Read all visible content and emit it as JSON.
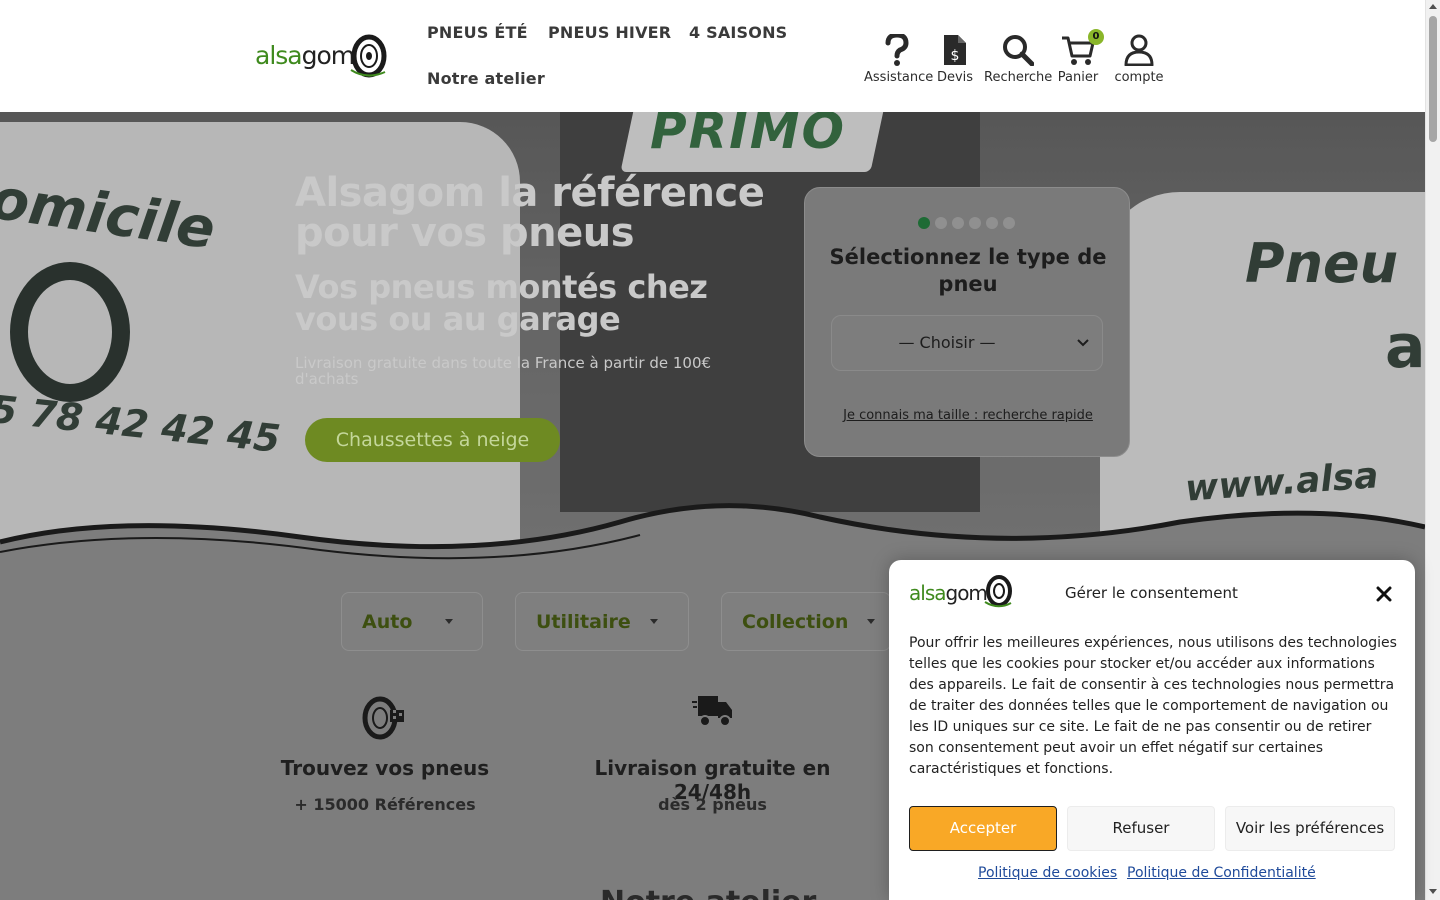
{
  "header": {
    "logo": {
      "part1": "alsa",
      "part2": "gom"
    },
    "nav": [
      {
        "label": "PNEUS ÉTÉ"
      },
      {
        "label": "PNEUS HIVER"
      },
      {
        "label": "4 SAISONS"
      },
      {
        "label": "Notre atelier"
      }
    ],
    "icons": [
      {
        "label": "Assistance",
        "icon": "question-icon"
      },
      {
        "label": "Devis",
        "icon": "quote-document-icon"
      },
      {
        "label": "Recherche",
        "icon": "search-icon"
      },
      {
        "label": "Panier",
        "icon": "cart-icon",
        "count": "0"
      },
      {
        "label": "compte",
        "icon": "user-icon"
      }
    ]
  },
  "hero": {
    "background_text": {
      "primo": "PRIMO",
      "left_van": "omicile",
      "phone": "5 78 42 42 45",
      "right_van": "Pneu",
      "url": "www.alsa",
      "right_letter": "a"
    },
    "title": "Alsagom la référence pour vos pneus",
    "subtitle": "Vos pneus montés chez vous ou au garage",
    "delivery_text": "Livraison gratuite dans toute la France à partir de 100€ d'achats",
    "button": "Chaussettes à neige",
    "selector": {
      "title": "Sélectionnez le type de pneu",
      "select_value": "— Choisir —",
      "quick_link": "Je connais ma taille : recherche rapide",
      "steps": 6,
      "active_step": 1
    }
  },
  "categories": [
    {
      "label": "Auto"
    },
    {
      "label": "Utilitaire"
    },
    {
      "label": "Collection"
    }
  ],
  "features": [
    {
      "title": "Trouvez vos pneus",
      "subtitle": "+ 15000 Références",
      "icon": "tire-flag-icon"
    },
    {
      "title": "Livraison gratuite en 24/48h",
      "subtitle": "dès 2 pneus",
      "icon": "delivery-truck-icon"
    }
  ],
  "peek_heading": "Notre atelier",
  "cookie": {
    "title": "Gérer le consentement",
    "text": "Pour offrir les meilleures expériences, nous utilisons des technologies telles que les cookies pour stocker et/ou accéder aux informations des appareils. Le fait de consentir à ces technologies nous permettra de traiter des données telles que le comportement de navigation ou les ID uniques sur ce site. Le fait de ne pas consentir ou de retirer son consentement peut avoir un effet négatif sur certaines caractéristiques et fonctions.",
    "accept": "Accepter",
    "refuse": "Refuser",
    "preferences": "Voir les préférences",
    "cookie_policy": "Politique de cookies",
    "privacy_policy": "Politique de Confidentialité"
  },
  "colors": {
    "brand_green": "#8ab62a",
    "dark_green": "#1e6b35",
    "accept_orange": "#f9a826",
    "link_blue": "#1f4a9a"
  }
}
